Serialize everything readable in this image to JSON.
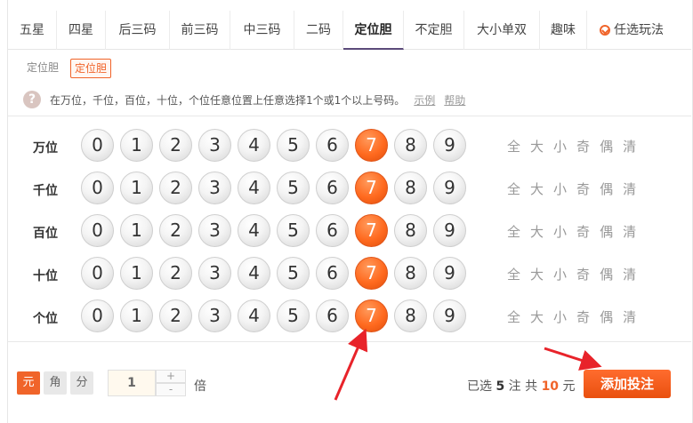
{
  "tabs": [
    {
      "label": "五星"
    },
    {
      "label": "四星"
    },
    {
      "label": "后三码"
    },
    {
      "label": "前三码"
    },
    {
      "label": "中三码"
    },
    {
      "label": "二码"
    },
    {
      "label": "定位胆"
    },
    {
      "label": "不定胆"
    },
    {
      "label": "大小单双"
    },
    {
      "label": "趣味"
    },
    {
      "label": "任选玩法"
    }
  ],
  "active_tab": "定位胆",
  "subtabs": {
    "group_label": "定位胆",
    "selected": "定位胆"
  },
  "hint": {
    "icon": "?",
    "text": "在万位，千位，百位，十位，个位任意位置上任意选择1个或1个以上号码。",
    "example_link": "示例",
    "help_link": "帮助"
  },
  "rows": [
    {
      "label": "万位",
      "selected": 7
    },
    {
      "label": "千位",
      "selected": 7
    },
    {
      "label": "百位",
      "selected": 7
    },
    {
      "label": "十位",
      "selected": 7
    },
    {
      "label": "个位",
      "selected": 7
    }
  ],
  "digits": [
    "0",
    "1",
    "2",
    "3",
    "4",
    "5",
    "6",
    "7",
    "8",
    "9"
  ],
  "quick_filters": [
    "全",
    "大",
    "小",
    "奇",
    "偶",
    "清"
  ],
  "units": [
    {
      "label": "元",
      "active": true
    },
    {
      "label": "角",
      "active": false
    },
    {
      "label": "分",
      "active": false
    }
  ],
  "multiplier": {
    "value": "1",
    "plus": "+",
    "minus": "-",
    "suffix": "倍"
  },
  "summary": {
    "prefix": "已选",
    "count": "5",
    "count_unit": "注",
    "total_label": "共",
    "total": "10",
    "total_unit": "元"
  },
  "add_button": "添加投注",
  "colors": {
    "accent": "#f0642a",
    "tab_active": "#5b4a7a",
    "arrow": "#e8232a"
  }
}
